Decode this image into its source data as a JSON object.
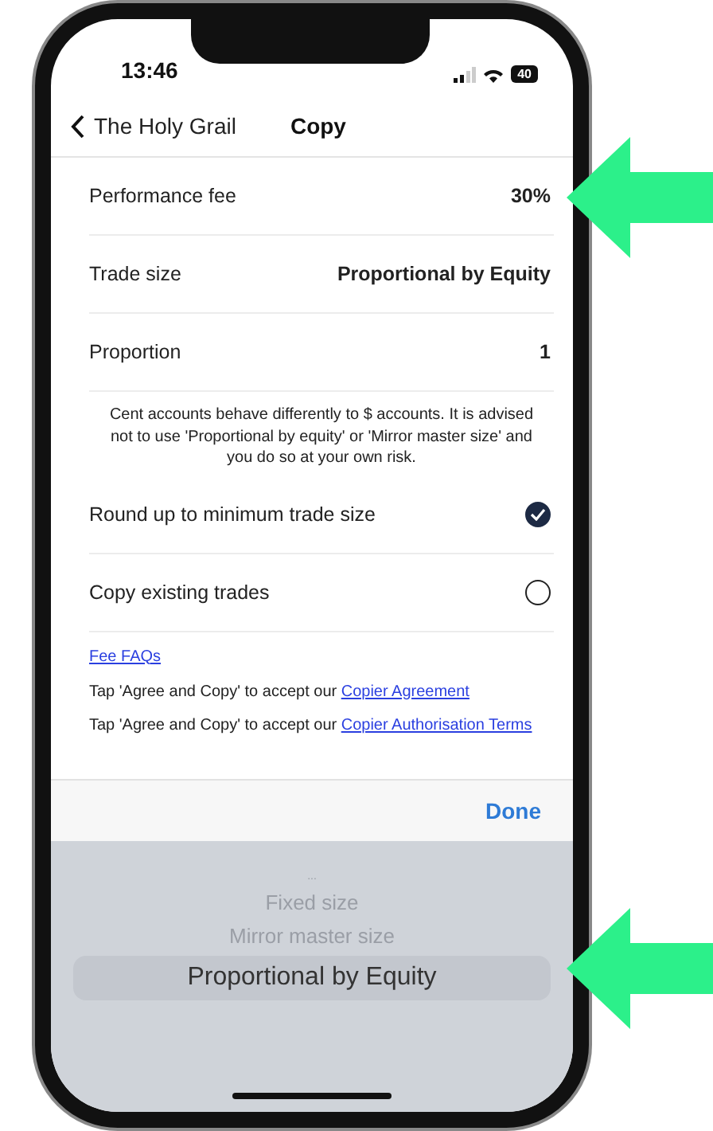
{
  "status_bar": {
    "time": "13:46",
    "battery": "40"
  },
  "nav": {
    "back_label": "The Holy Grail",
    "title": "Copy"
  },
  "settings": [
    {
      "label": "Performance fee",
      "value": "30%"
    },
    {
      "label": "Trade size",
      "value": "Proportional by Equity"
    },
    {
      "label": "Proportion",
      "value": "1"
    }
  ],
  "note": "Cent accounts behave differently to $ accounts. It is advised not to use 'Proportional by equity' or 'Mirror master size' and you do so at your own risk.",
  "options": [
    {
      "label": "Round up to minimum trade size",
      "checked": true
    },
    {
      "label": "Copy existing trades",
      "checked": false
    }
  ],
  "fee_link": "Fee FAQs",
  "agreements": [
    {
      "text": "Tap 'Agree and Copy' to accept our",
      "link": "Copier Agreement"
    },
    {
      "text": "Tap 'Agree and Copy' to accept our",
      "link": "Copier Authorisation Terms"
    }
  ],
  "toolbar": {
    "done": "Done"
  },
  "picker": [
    {
      "label": "...",
      "selected": false
    },
    {
      "label": "Fixed size",
      "selected": false
    },
    {
      "label": "Mirror master size",
      "selected": false
    },
    {
      "label": "Proportional by Equity",
      "selected": true
    }
  ]
}
